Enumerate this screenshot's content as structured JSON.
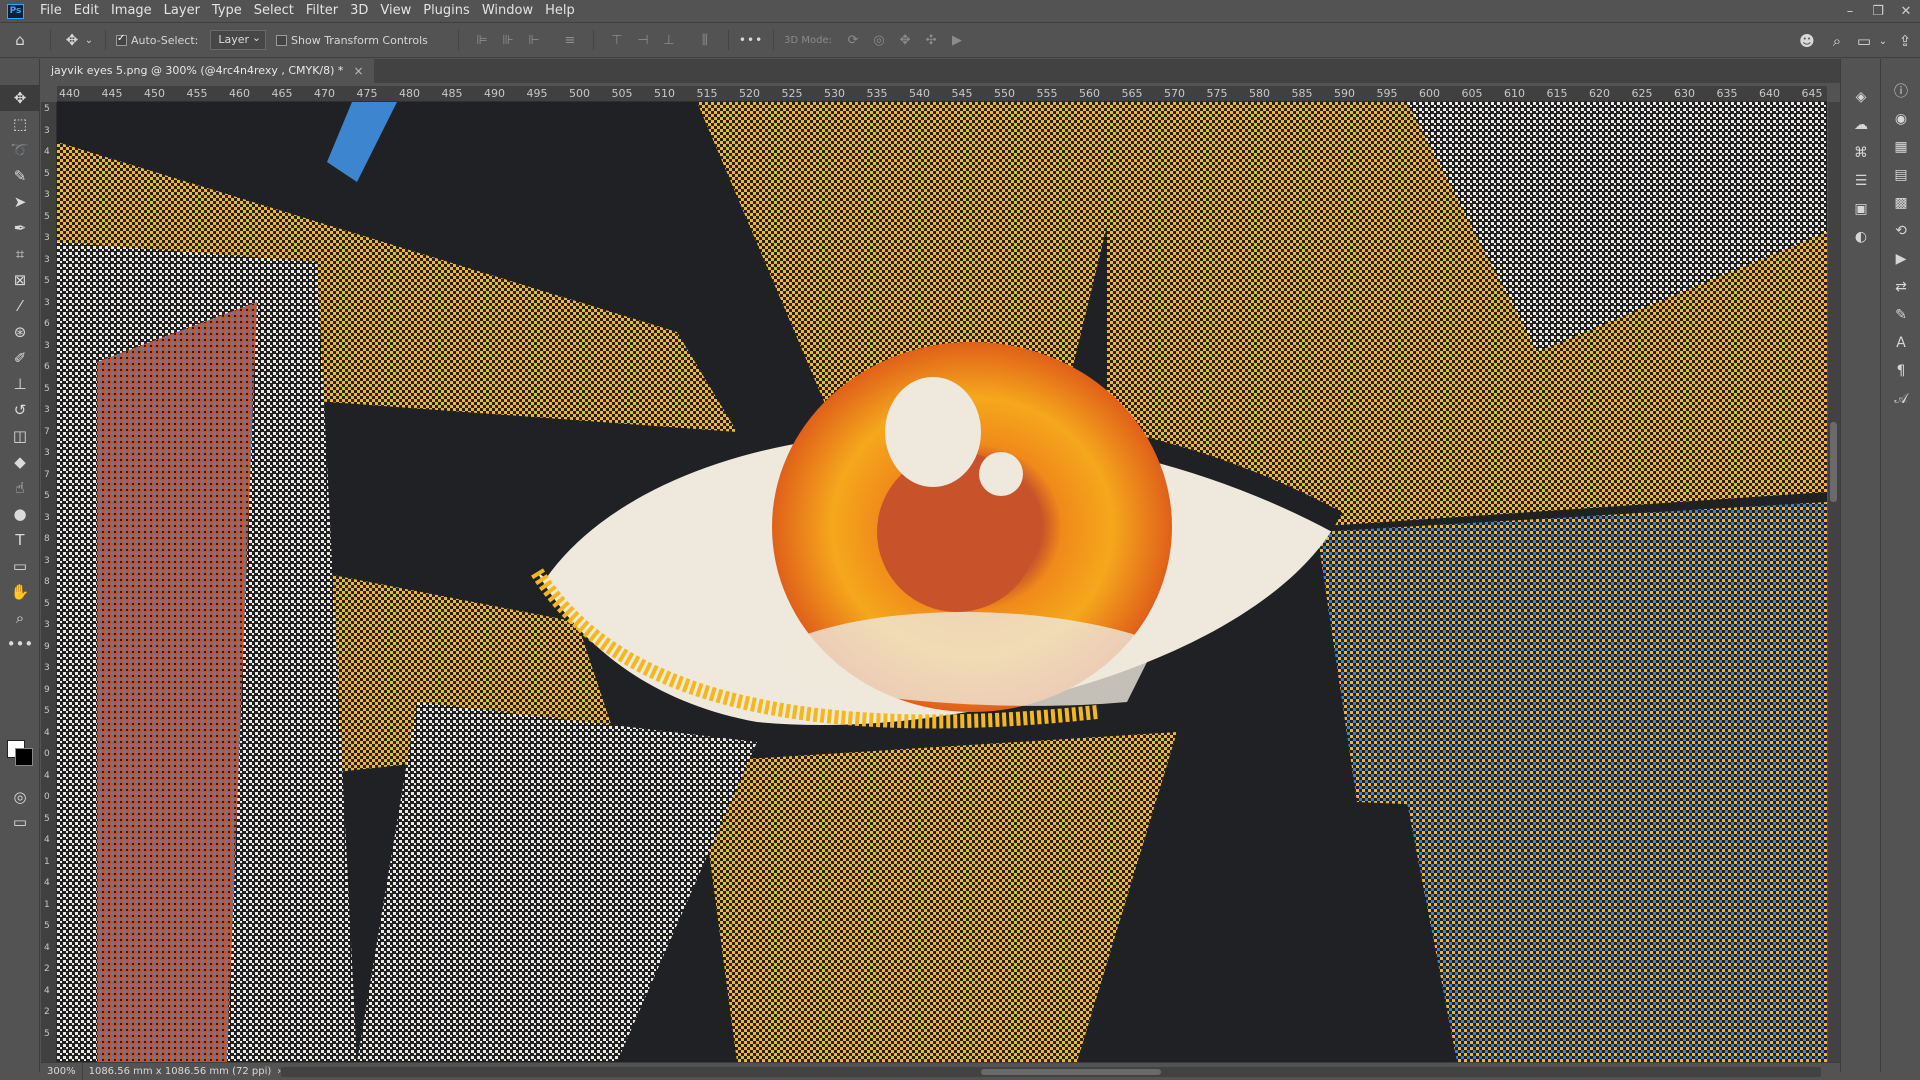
{
  "app": {
    "logo": "Ps"
  },
  "menu": [
    "File",
    "Edit",
    "Image",
    "Layer",
    "Type",
    "Select",
    "Filter",
    "3D",
    "View",
    "Plugins",
    "Window",
    "Help"
  ],
  "window_controls": [
    "minimize-icon",
    "restore-icon",
    "close-icon"
  ],
  "options": {
    "auto_select_label": "Auto-Select:",
    "auto_select_checked": true,
    "target_value": "Layer",
    "show_transform_label": "Show Transform Controls",
    "show_transform_checked": false,
    "more_label": "•••",
    "mode_3d_label": "3D Mode:"
  },
  "document_tab": {
    "title": "jayvik eyes 5.png @ 300% (@4rc4n4rexy , CMYK/8) *",
    "close": "×"
  },
  "ruler_top_labels": [
    "440",
    "445",
    "450",
    "455",
    "460",
    "465",
    "470",
    "475",
    "480",
    "485",
    "490",
    "495",
    "500",
    "505",
    "510",
    "515",
    "520",
    "525",
    "530",
    "535",
    "540",
    "545",
    "550",
    "555",
    "560",
    "565",
    "570",
    "575",
    "580",
    "585",
    "590",
    "595",
    "600",
    "605",
    "610",
    "615",
    "620",
    "625",
    "630",
    "635",
    "640",
    "645"
  ],
  "ruler_left_labels": [
    "5",
    "3",
    "4",
    "5",
    "3",
    "5",
    "3",
    "3",
    "5",
    "3",
    "6",
    "3",
    "6",
    "5",
    "3",
    "7",
    "3",
    "7",
    "5",
    "3",
    "8",
    "3",
    "8",
    "5",
    "3",
    "9",
    "3",
    "9",
    "5",
    "4",
    "0",
    "4",
    "0",
    "5",
    "4",
    "1",
    "4",
    "1",
    "5",
    "4",
    "2",
    "4",
    "2",
    "5"
  ],
  "tools": [
    {
      "name": "move-tool",
      "glyph": "✥"
    },
    {
      "name": "marquee-tool",
      "glyph": "⬚"
    },
    {
      "name": "lasso-tool",
      "glyph": "➰"
    },
    {
      "name": "magic-wand-tool",
      "glyph": "✎"
    },
    {
      "name": "path-select-tool",
      "glyph": "➤"
    },
    {
      "name": "pen-tool",
      "glyph": "✒"
    },
    {
      "name": "crop-tool",
      "glyph": "⌗"
    },
    {
      "name": "frame-tool",
      "glyph": "⊠"
    },
    {
      "name": "eyedropper-tool",
      "glyph": "⁄"
    },
    {
      "name": "healing-tool",
      "glyph": "⊛"
    },
    {
      "name": "brush-tool",
      "glyph": "✐"
    },
    {
      "name": "stamp-tool",
      "glyph": "⊥"
    },
    {
      "name": "history-brush-tool",
      "glyph": "↺"
    },
    {
      "name": "eraser-tool",
      "glyph": "◫"
    },
    {
      "name": "paint-bucket-tool",
      "glyph": "◆"
    },
    {
      "name": "smudge-tool",
      "glyph": "☝"
    },
    {
      "name": "dodge-tool",
      "glyph": "●"
    },
    {
      "name": "type-tool",
      "glyph": "T"
    },
    {
      "name": "shape-tool",
      "glyph": "▭"
    },
    {
      "name": "hand-tool",
      "glyph": "✋"
    },
    {
      "name": "zoom-tool",
      "glyph": "⌕"
    },
    {
      "name": "edit-toolbar-button",
      "glyph": "•••"
    }
  ],
  "right_panel_icons_a": [
    {
      "name": "layers-icon",
      "glyph": "◈"
    },
    {
      "name": "channels-icon",
      "glyph": "☁"
    },
    {
      "name": "paths-icon",
      "glyph": "⌘"
    },
    {
      "name": "properties-icon",
      "glyph": "☰"
    },
    {
      "name": "libraries-icon",
      "glyph": "▣"
    },
    {
      "name": "adjustments-icon",
      "glyph": "◐"
    }
  ],
  "right_panel_icons_b": [
    {
      "name": "info-icon",
      "glyph": "ⓘ"
    },
    {
      "name": "color-icon",
      "glyph": "◉"
    },
    {
      "name": "swatches-icon",
      "glyph": "▦"
    },
    {
      "name": "gradients-icon",
      "glyph": "▤"
    },
    {
      "name": "patterns-icon",
      "glyph": "▩"
    },
    {
      "name": "history-icon",
      "glyph": "⟲"
    },
    {
      "name": "actions-icon",
      "glyph": "▶"
    },
    {
      "name": "brush-settings-icon",
      "glyph": "⇄"
    },
    {
      "name": "brushes-icon",
      "glyph": "✎"
    },
    {
      "name": "character-icon",
      "glyph": "A"
    },
    {
      "name": "paragraph-icon",
      "glyph": "¶"
    },
    {
      "name": "glyphs-icon",
      "glyph": "𝒜"
    }
  ],
  "status": {
    "zoom": "300%",
    "doc_info": "1086.56 mm x 1086.56 mm (72 ppi)",
    "arrow": "›"
  },
  "artwork": {
    "colors": {
      "background": "#202124",
      "yellow": "#f5b81c",
      "cream": "#efe8dc",
      "orange": "#f08a1a",
      "rust": "#c8522a",
      "blue": "#3d86cf"
    }
  }
}
